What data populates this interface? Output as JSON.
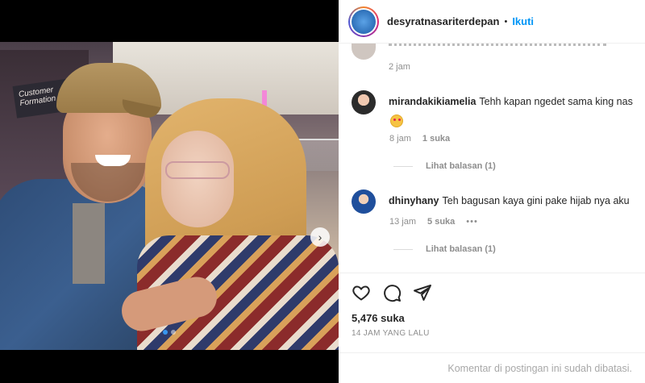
{
  "post": {
    "username": "desyratnasariterdepan",
    "separator": "•",
    "follow_label": "Ikuti",
    "carousel_next_icon": "chevron-right-icon",
    "carousel": {
      "count": 2,
      "active_index": 0
    },
    "photo_sign_text": "Customer Formation"
  },
  "comments": {
    "top_time": "2 jam",
    "items": [
      {
        "username": "mirandakikiamelia",
        "text": "Tehh kapan ngedet sama king nas",
        "emoji": "star-struck-emoji",
        "time": "8 jam",
        "likes": "1 suka",
        "replies": "Lihat balasan (1)",
        "avatar_color": "#2b2b2b"
      },
      {
        "username": "dhinyhany",
        "text": "Teh bagusan kaya gini pake hijab nya aku",
        "time": "13 jam",
        "likes": "5 suka",
        "more": "•••",
        "replies": "Lihat balasan (1)",
        "avatar_color": "#1f4f9c"
      }
    ]
  },
  "actions": {
    "icons": [
      "heart-icon",
      "comment-icon",
      "share-icon"
    ],
    "likes_count": "5,476 suka",
    "timestamp": "14 JAM YANG LALU"
  },
  "footer": {
    "comments_limited": "Komentar di postingan ini sudah dibatasi."
  },
  "colors": {
    "accent": "#0095f6",
    "carousel_active": "#3897f0",
    "text_primary": "#262626",
    "text_secondary": "#8e8e8e"
  }
}
